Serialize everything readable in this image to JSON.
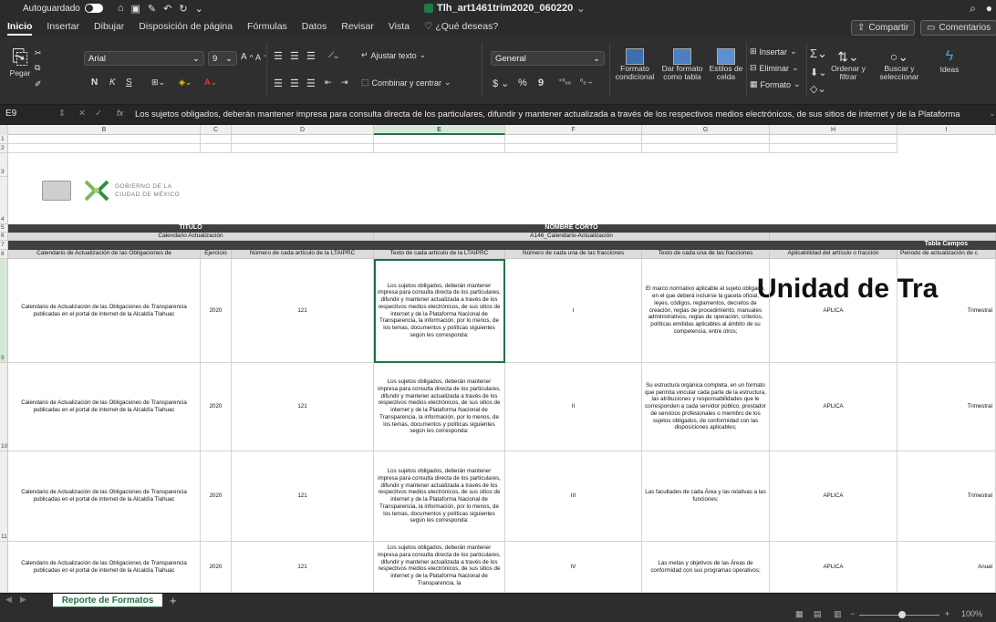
{
  "titlebar": {
    "autosave": "Autoguardado",
    "doc_title": "Tlh_art1461trim2020_060220",
    "chevron": "⌄"
  },
  "menu": {
    "tabs": [
      "Inicio",
      "Insertar",
      "Dibujar",
      "Disposición de página",
      "Fórmulas",
      "Datos",
      "Revisar",
      "Vista"
    ],
    "tell_me": "¿Qué deseas?",
    "share": "Compartir",
    "comments": "Comentarios"
  },
  "ribbon": {
    "paste": "Pegar",
    "font": "Arial",
    "size": "9",
    "bold": "N",
    "italic": "K",
    "underline": "S",
    "wrap": "Ajustar texto",
    "merge": "Combinar y centrar",
    "number_format": "General",
    "currency": "$",
    "percent": "%",
    "comma": "9",
    "cond_format": "Formato condicional",
    "table_format": "Dar formato como tabla",
    "cell_styles": "Estilos de celda",
    "insert": "Insertar",
    "delete": "Eliminar",
    "format": "Formato",
    "sort": "Ordenar y filtrar",
    "find": "Buscar y seleccionar",
    "ideas": "Ideas"
  },
  "formula": {
    "name_box": "E9",
    "fx": "fx",
    "content": "Los sujetos obligados, deberán mantener impresa para consulta directa de los particulares, difundir y mantener actualizada a través de los respectivos medios electrónicos, de sus sitios de internet y de la Plataforma"
  },
  "columns": [
    "B",
    "C",
    "D",
    "E",
    "F",
    "G",
    "H",
    "I"
  ],
  "rows": [
    "1",
    "2",
    "3",
    "4",
    "5",
    "6",
    "7",
    "8",
    "9",
    "10",
    "11"
  ],
  "logo": {
    "line1": "GOBIERNO DE LA",
    "line2": "CIUDAD DE MÉXICO"
  },
  "sheet": {
    "big_title": "Unidad de Tra",
    "titulo": "TÍTULO",
    "titulo_val": "Calendario Actualización",
    "nombre_corto": "NOMBRE CORTO",
    "nombre_corto_val": "A146_Calendario-Actualización",
    "tabla_campos": "Tabla Campos",
    "headers": [
      "Calendario de Actualización de las Obligaciones de",
      "Ejercicio",
      "Número de cada artículo de la LTAIPRC",
      "Texto de cada artículo de la LTAIPRC",
      "Número de cada una de las fracciones",
      "Texto de cada una de las fracciones",
      "Aplicabilidad del artículo o fracción",
      "Periodo de actualización de c"
    ],
    "data_rows": [
      {
        "b": "Calendario de Actualización de las Obligaciones de Transparencia publicadas en el portal de internet de la Alcaldía Tlahuac",
        "c": "2020",
        "d": "121",
        "e": "Los sujetos obligados, deberán mantener impresa para consulta directa de los particulares, difundir y mantener actualizada a través de los respectivos medios electrónicos, de sus sitios de internet y de la Plataforma Nacional de Transparencia, la información, por lo menos, de los temas, documentos y políticas siguientes según les corresponda:",
        "f": "I",
        "g": "El marco normativo aplicable al sujeto obligado, en el que deberá incluirse la gaceta oficial, leyes, códigos, reglamentos, decretos de creación, reglas de procedimiento, manuales administrativos, reglas de operación, criterios, políticas emitidas aplicables al ámbito de su competencia, entre otros;",
        "h": "APLICA",
        "i": "Trimestral"
      },
      {
        "b": "Calendario de Actualización de las Obligaciones de Transparencia publicadas en el portal de internet de la Alcaldía Tlahuac",
        "c": "2020",
        "d": "121",
        "e": "Los sujetos obligados, deberán mantener impresa para consulta directa de los particulares, difundir y mantener actualizada a través de los respectivos medios electrónicos, de sus sitios de internet y de la Plataforma Nacional de Transparencia, la información, por lo menos, de los temas, documentos y políticas siguientes según les corresponda:",
        "f": "II",
        "g": "Su estructura orgánica completa, en un formato que permita vincular cada parte de la estructura, las atribuciones y responsabilidades que le corresponden a cada servidor público, prestador de servicios profesionales o miembro de los sujetos obligados, de conformidad con las disposiciones aplicables;",
        "h": "APLICA",
        "i": "Trimestral"
      },
      {
        "b": "Calendario de Actualización de las Obligaciones de Transparencia publicadas en el portal de internet de la Alcaldía Tlahuac",
        "c": "2020",
        "d": "121",
        "e": "Los sujetos obligados, deberán mantener impresa para consulta directa de los particulares, difundir y mantener actualizada a través de los respectivos medios electrónicos, de sus sitios de internet y de la Plataforma Nacional de Transparencia, la información, por lo menos, de los temas, documentos y políticas siguientes según les corresponda:",
        "f": "III",
        "g": "Las facultades de cada Área y las relativas a las funciones;",
        "h": "APLICA",
        "i": "Trimestral"
      },
      {
        "b": "Calendario de Actualización de las Obligaciones de Transparencia publicadas en el portal de internet de la Alcaldía Tlahuac",
        "c": "2020",
        "d": "121",
        "e": "Los sujetos obligados, deberán mantener impresa para consulta directa de los particulares, difundir y mantener actualizada a través de los respectivos medios electrónicos, de sus sitios de internet y de la Plataforma Nacional de Transparencia, la",
        "f": "IV",
        "g": "Las metas y objetivos de las Áreas de conformidad con sus programas operativos;",
        "h": "APLICA",
        "i": "Anual"
      }
    ]
  },
  "sheettab": "Reporte de Formatos",
  "add_sheet": "+",
  "zoom": "100%"
}
